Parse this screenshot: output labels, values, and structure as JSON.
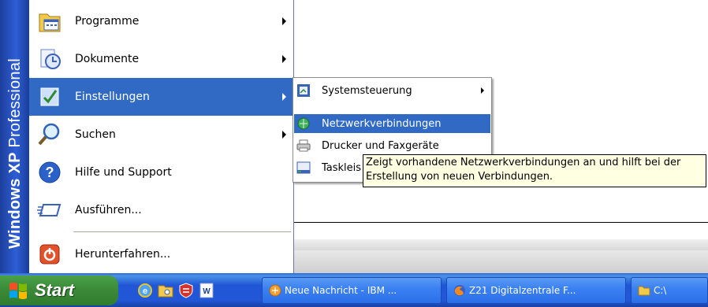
{
  "start_menu": {
    "sidebar_brand": "Windows XP",
    "sidebar_edition": "Professional",
    "items": [
      {
        "label": "Programme",
        "icon": "programs-icon",
        "has_submenu": true
      },
      {
        "label": "Dokumente",
        "icon": "documents-icon",
        "has_submenu": true
      },
      {
        "label": "Einstellungen",
        "icon": "settings-icon",
        "has_submenu": true,
        "selected": true
      },
      {
        "label": "Suchen",
        "icon": "search-icon",
        "has_submenu": true
      },
      {
        "label": "Hilfe und Support",
        "icon": "help-icon",
        "has_submenu": false
      },
      {
        "label": "Ausführen...",
        "icon": "run-icon",
        "has_submenu": false
      }
    ],
    "shutdown_label": "Herunterfahren..."
  },
  "submenu": {
    "items": [
      {
        "label": "Systemsteuerung",
        "icon": "control-panel-icon",
        "has_submenu": true
      },
      {
        "label": "Netzwerkverbindungen",
        "icon": "network-connections-icon",
        "selected": true
      },
      {
        "label": "Drucker und Faxgeräte",
        "icon": "printer-icon"
      },
      {
        "label": "Taskleis",
        "icon": "taskbar-icon"
      }
    ]
  },
  "tooltip": {
    "line1": "Zeigt vorhandene Netzwerkverbindungen an und hilft bei der",
    "line2": "Erstellung von neuen Verbindungen."
  },
  "taskbar": {
    "start_label": "Start",
    "quick_launch": [
      "ie-icon",
      "explorer-folder-icon",
      "firewall-icon",
      "word-icon"
    ],
    "tasks": [
      {
        "label": "Neue Nachricht - IBM ...",
        "icon": "mail-icon"
      },
      {
        "label": "Z21 Digitalzentrale F...",
        "icon": "firefox-icon"
      },
      {
        "label": "C:\\",
        "icon": "folder-icon"
      }
    ]
  },
  "colors": {
    "selection": "#316ac5",
    "sidebar": "#2e5ed6",
    "taskbar": "#2157d7",
    "start_button": "#3c8b3a",
    "tooltip_bg": "#ffffe1"
  }
}
